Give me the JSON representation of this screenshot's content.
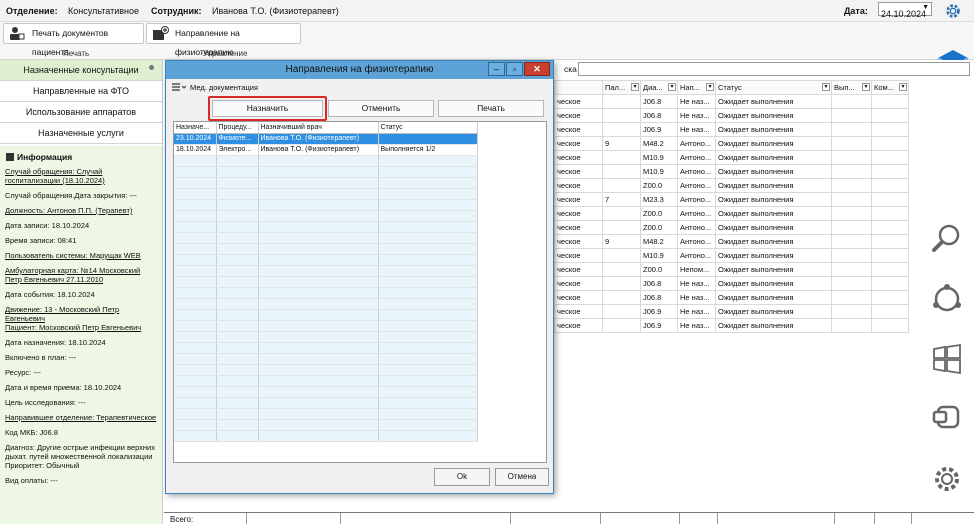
{
  "topbar": {
    "dept_label": "Отделение:",
    "dept_value": "Консультативное",
    "employee_label": "Сотрудник:",
    "employee_value": "Иванова Т.О. (Физиотерапевт)",
    "date_label": "Дата:",
    "date_value": "24.10.2024"
  },
  "ribbon": {
    "print_docs": "Печать документов пациента",
    "physio_referral": "Направление на физиотерапию",
    "group_print": "Печать",
    "group_manage": "Управление"
  },
  "leftnav": {
    "items": [
      "Назначенные консультации",
      "Направленные на ФТО",
      "Использование аппаратов",
      "Назначенные услуги"
    ]
  },
  "info": {
    "title": "Информация",
    "lines": [
      {
        "text": "Случай обращения: Случай\nгоспитализации (18.10.2024)",
        "u": true
      },
      {
        "text": "Случай обращения.Дата закрытия: ---",
        "u": false
      },
      {
        "text": "Должность: Антонов П.П. (Терапевт)",
        "u": true
      },
      {
        "text": "Дата записи: 18.10.2024",
        "u": false
      },
      {
        "text": "Время записи: 08:41",
        "u": false
      },
      {
        "text": "Пользователь системы: Марущак WEB",
        "u": true
      },
      {
        "text": "Амбулаторная карта: №14 Московский\nПетр Евгеньевич 27.11.2010",
        "u": true
      },
      {
        "text": "Дата события: 18.10.2024",
        "u": false
      },
      {
        "text": "Движение: 13 - Московский Петр\nЕвгеньевич\nПациент: Московский Петр Евгеньевич",
        "u": true
      },
      {
        "text": "Дата назначения: 18.10.2024",
        "u": false
      },
      {
        "text": "Включено в план: ---",
        "u": false
      },
      {
        "text": "Ресурс: ---",
        "u": false
      },
      {
        "text": "Дата и время приема: 18.10.2024",
        "u": false
      },
      {
        "text": "Цель исследования: ---",
        "u": false
      },
      {
        "text": "Направившее отделение: Терапевтическое",
        "u": true
      },
      {
        "text": "Код МКБ: J06.8",
        "u": false
      },
      {
        "text": "Диагноз: Другие острые инфекции верхних\nдыхат. путей множественной локализации\nПриоритет: Обычный",
        "u": false
      },
      {
        "text": "Вид оплаты: ---",
        "u": false
      }
    ]
  },
  "bgtable": {
    "search_label": "ска",
    "headers": [
      "",
      "Пал...",
      "Диа...",
      "Нап...",
      "Статус",
      "Вып...",
      "Ком..."
    ],
    "rows": [
      [
        "ческое",
        "",
        "J06.8",
        "Не наз...",
        "Ожидает выполнения",
        "",
        ""
      ],
      [
        "ческое",
        "",
        "J06.8",
        "Не наз...",
        "Ожидает выполнения",
        "",
        ""
      ],
      [
        "ческое",
        "",
        "J06.9",
        "Не наз...",
        "Ожидает выполнения",
        "",
        ""
      ],
      [
        "ческое",
        "9",
        "M48.2",
        "Антоно...",
        "Ожидает выполнения",
        "",
        ""
      ],
      [
        "ческое",
        "",
        "M10.9",
        "Антоно...",
        "Ожидает выполнения",
        "",
        ""
      ],
      [
        "ческое",
        "",
        "M10.9",
        "Антоно...",
        "Ожидает выполнения",
        "",
        ""
      ],
      [
        "ческое",
        "",
        "Z00.0",
        "Антоно...",
        "Ожидает выполнения",
        "",
        ""
      ],
      [
        "ческое",
        "7",
        "M23.3",
        "Антоно...",
        "Ожидает выполнения",
        "",
        ""
      ],
      [
        "ческое",
        "",
        "Z00.0",
        "Антоно...",
        "Ожидает выполнения",
        "",
        ""
      ],
      [
        "ческое",
        "",
        "Z00.0",
        "Антоно...",
        "Ожидает выполнения",
        "",
        ""
      ],
      [
        "ческое",
        "9",
        "M48.2",
        "Антоно...",
        "Ожидает выполнения",
        "",
        ""
      ],
      [
        "ческое",
        "",
        "M10.9",
        "Антоно...",
        "Ожидает выполнения",
        "",
        ""
      ],
      [
        "ческое",
        "",
        "Z00.0",
        "Непом...",
        "Ожидает выполнения",
        "",
        ""
      ],
      [
        "ческое",
        "",
        "J06.8",
        "Не наз...",
        "Ожидает выполнения",
        "",
        ""
      ],
      [
        "ческое",
        "",
        "J06.8",
        "Не наз...",
        "Ожидает выполнения",
        "",
        ""
      ],
      [
        "ческое",
        "",
        "J06.9",
        "Не наз...",
        "Ожидает выполнения",
        "",
        ""
      ],
      [
        "ческое",
        "",
        "J06.9",
        "Не наз...",
        "Ожидает выполнения",
        "",
        ""
      ]
    ],
    "total_label": "Всего:"
  },
  "dialog": {
    "title": "Направления на физиотерапию",
    "med_docs": "Мед. документация",
    "btn_assign": "Назначить",
    "btn_cancel": "Отменить",
    "btn_print": "Печать",
    "headers": [
      "Назначе...",
      "Процеду...",
      "Назначивший врач",
      "Статус"
    ],
    "rows": [
      [
        "23.10.2024",
        "Физиоте...",
        "Иванова Т.О. (Физиотерапевт)",
        ""
      ],
      [
        "18.10.2024",
        "Электро...",
        "Иванова Т.О. (Физиотерапевт)",
        "Выполняется 1/2"
      ]
    ],
    "ok": "Ok",
    "cancel": "Отмена"
  }
}
